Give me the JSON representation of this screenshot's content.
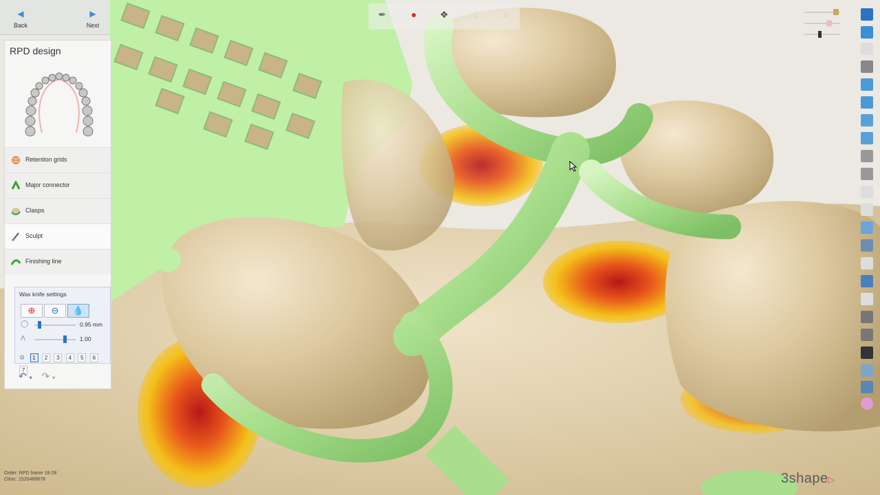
{
  "nav": {
    "back_label": "Back",
    "next_label": "Next"
  },
  "panel": {
    "title": "RPD design",
    "steps": [
      {
        "label": "Retention grids",
        "icon": "retention-grid-icon"
      },
      {
        "label": "Major connector",
        "icon": "major-connector-icon"
      },
      {
        "label": "Clasps",
        "icon": "clasp-icon"
      },
      {
        "label": "Sculpt",
        "icon": "sculpt-knife-icon",
        "active": true
      },
      {
        "label": "Finishing line",
        "icon": "finishing-line-icon"
      }
    ]
  },
  "wax": {
    "title": "Wax knife settings",
    "size_value": "0.95 mm",
    "strength_value": "1.00",
    "numbers": [
      "1",
      "2",
      "3",
      "4",
      "5",
      "6",
      "7"
    ],
    "selected_number": "1"
  },
  "footer": {
    "order_line": "Order:  RPD frame 18-28",
    "clinic_line": "Clinic:   1520489678"
  },
  "brand": {
    "logo_text": "3shape"
  },
  "colors": {
    "framework_green": "#b6e59a",
    "tooth_beige": "#d6c195",
    "contact_yellow": "#f3c418",
    "contact_red": "#c8201e",
    "accent_blue": "#2c73c0"
  }
}
